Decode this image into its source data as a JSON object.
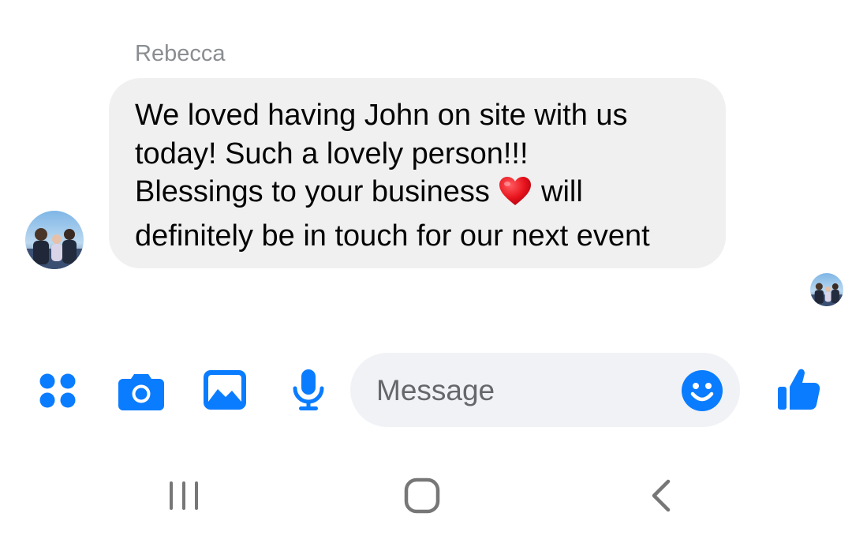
{
  "conversation": {
    "sender_name": "Rebecca",
    "message_lines": [
      "We loved having John on site with us",
      "today! Such a lovely person!!!",
      "Blessings to your business",
      "will",
      "definitely be in touch for our next event"
    ],
    "inline_emoji": "red-heart"
  },
  "composer": {
    "placeholder": "Message",
    "icons": [
      "menu-dots-icon",
      "camera-icon",
      "image-icon",
      "microphone-icon",
      "emoji-icon",
      "thumbs-up-icon"
    ],
    "accent_color": "#0a7cff"
  },
  "system_nav": {
    "buttons": [
      "recent-apps",
      "home",
      "back"
    ]
  },
  "colors": {
    "bubble_bg": "#f0f0f0",
    "sender_name": "#8a8d91",
    "input_bg": "#f0f2f5",
    "nav_icon": "#777777",
    "heart": "#e8141d"
  }
}
